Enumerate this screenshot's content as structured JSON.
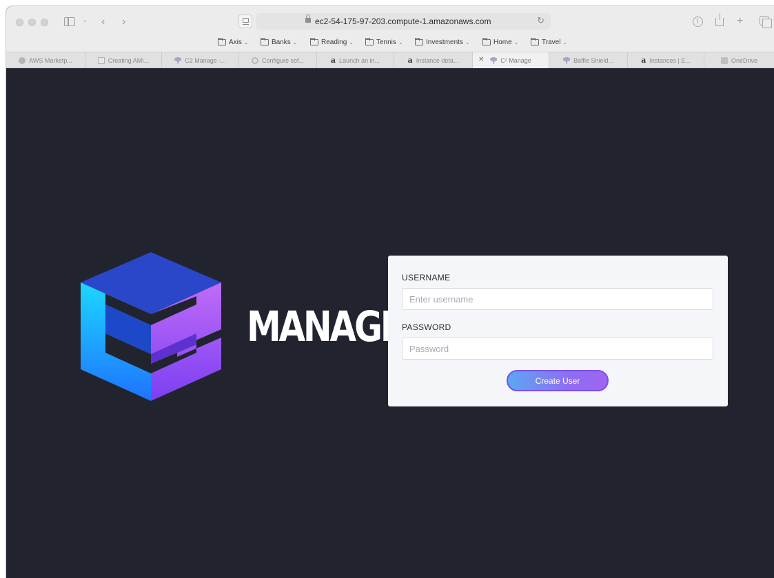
{
  "browser": {
    "url": "ec2-54-175-97-203.compute-1.amazonaws.com",
    "favorites": [
      {
        "label": "Axis"
      },
      {
        "label": "Banks"
      },
      {
        "label": "Reading"
      },
      {
        "label": "Tennis"
      },
      {
        "label": "Investments"
      },
      {
        "label": "Home"
      },
      {
        "label": "Travel"
      }
    ],
    "tabs": [
      {
        "label": "AWS Marketp...",
        "icon": "globe-icon"
      },
      {
        "label": "Creating AMI...",
        "icon": "page-icon"
      },
      {
        "label": "C2 Manage -...",
        "icon": "c2-icon"
      },
      {
        "label": "Configure sof...",
        "icon": "gear-icon"
      },
      {
        "label": "Launch an in...",
        "icon": "amazon-icon"
      },
      {
        "label": "Instance deta...",
        "icon": "amazon-icon"
      },
      {
        "label": "C² Manage",
        "icon": "c2-icon",
        "active": true
      },
      {
        "label": "Baffle Shield...",
        "icon": "c2-icon"
      },
      {
        "label": "Instances | E...",
        "icon": "amazon-icon"
      },
      {
        "label": "OneDrive",
        "icon": "onedrive-icon"
      }
    ]
  },
  "brand": {
    "name": "MANAGE",
    "colors": {
      "cyan": "#00e5ff",
      "blue": "#2e4fd6",
      "purple": "#b36cf5",
      "dark_bg": "#21242f"
    }
  },
  "form": {
    "username_label": "USERNAME",
    "username_placeholder": "Enter username",
    "password_label": "PASSWORD",
    "password_placeholder": "Password",
    "submit_label": "Create User"
  }
}
